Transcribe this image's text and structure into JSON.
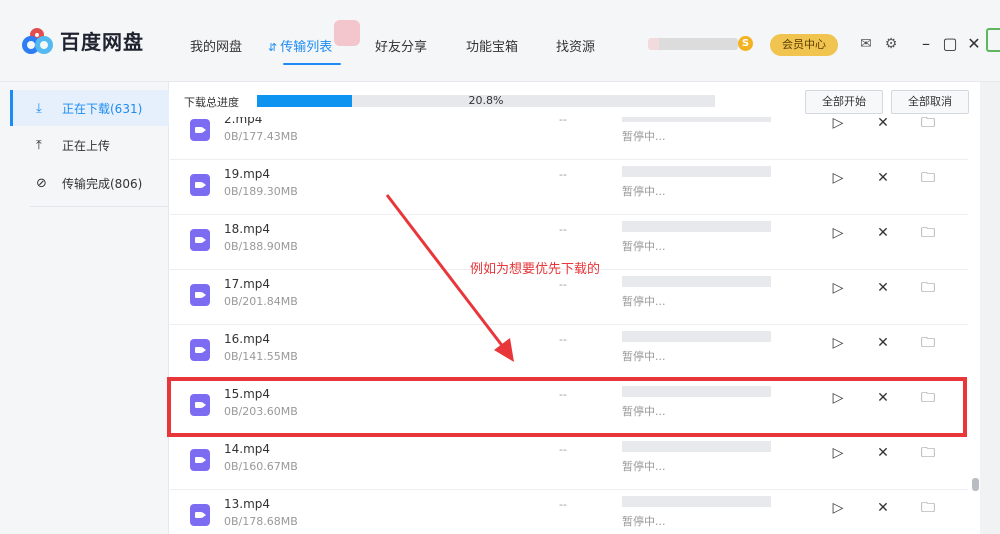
{
  "app": {
    "title": "百度网盘"
  },
  "nav": {
    "items": [
      {
        "label": "我的网盘"
      },
      {
        "label": "传输列表"
      },
      {
        "label": "好友分享"
      },
      {
        "label": "功能宝箱"
      },
      {
        "label": "找资源"
      }
    ]
  },
  "header": {
    "vip_badge": "S",
    "vip_button": "会员中心",
    "icons": [
      "mail-icon",
      "settings-icon",
      "minimize-icon",
      "maximize-icon",
      "close-icon"
    ]
  },
  "sidebar": {
    "items": [
      {
        "label": "正在下载(631)"
      },
      {
        "label": "正在上传"
      },
      {
        "label": "传输完成(806)"
      }
    ]
  },
  "progress": {
    "label": "下载总进度",
    "value": 20.8,
    "text": "20.8%",
    "start_all": "全部开始",
    "cancel_all": "全部取消"
  },
  "files": [
    {
      "name": "2.mp4",
      "size": "0B/177.43MB",
      "speed": "--",
      "status": "暂停中..."
    },
    {
      "name": "19.mp4",
      "size": "0B/189.30MB",
      "speed": "--",
      "status": "暂停中..."
    },
    {
      "name": "18.mp4",
      "size": "0B/188.90MB",
      "speed": "--",
      "status": "暂停中..."
    },
    {
      "name": "17.mp4",
      "size": "0B/201.84MB",
      "speed": "--",
      "status": "暂停中..."
    },
    {
      "name": "16.mp4",
      "size": "0B/141.55MB",
      "speed": "--",
      "status": "暂停中..."
    },
    {
      "name": "15.mp4",
      "size": "0B/203.60MB",
      "speed": "--",
      "status": "暂停中..."
    },
    {
      "name": "14.mp4",
      "size": "0B/160.67MB",
      "speed": "--",
      "status": "暂停中..."
    },
    {
      "name": "13.mp4",
      "size": "0B/178.68MB",
      "speed": "--",
      "status": "暂停中..."
    }
  ],
  "annotation": {
    "text": "例如为想要优先下载的",
    "color": "#e8363a"
  },
  "colors": {
    "accent": "#1c8cf2",
    "progress_fill": "#0f93f0",
    "video_icon": "#7c6cf1",
    "vip": "#f0c44e"
  }
}
